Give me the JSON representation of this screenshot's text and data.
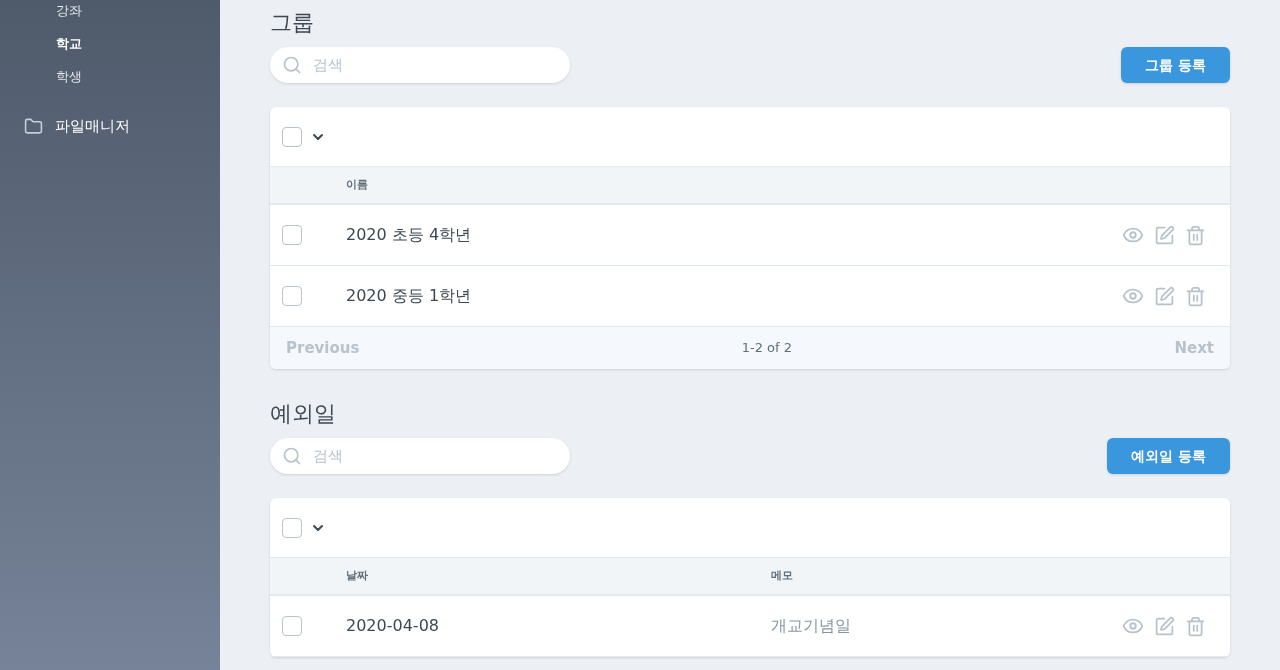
{
  "sidebar": {
    "items": [
      {
        "label": "강좌",
        "selected": false
      },
      {
        "label": "학교",
        "selected": true
      },
      {
        "label": "학생",
        "selected": false
      }
    ],
    "folder_item": {
      "label": "파일매니저"
    }
  },
  "sections": [
    {
      "title": "그룹",
      "search": {
        "placeholder": "검색"
      },
      "add_button": "그룹 등록",
      "select_all_checked": false,
      "columns": [
        "이름"
      ],
      "rows": [
        {
          "cells": [
            "2020 초등 4학년"
          ],
          "checked": false
        },
        {
          "cells": [
            "2020 중등 1학년"
          ],
          "checked": false
        }
      ],
      "pagination": {
        "previous": "Previous",
        "range": "1-2 of 2",
        "next": "Next"
      }
    },
    {
      "title": "예외일",
      "search": {
        "placeholder": "검색"
      },
      "add_button": "예외일 등록",
      "select_all_checked": false,
      "columns": [
        "날짜",
        "메모"
      ],
      "rows": [
        {
          "cells": [
            "2020-04-08",
            "개교기념일"
          ],
          "checked": false
        }
      ]
    }
  ]
}
